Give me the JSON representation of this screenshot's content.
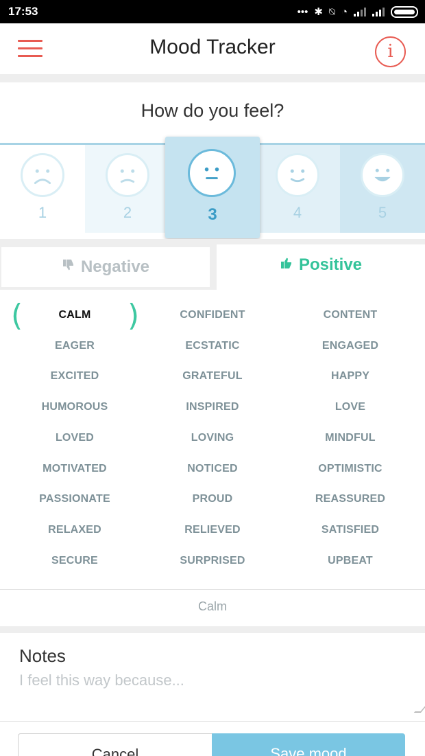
{
  "status_bar": {
    "time": "17:53",
    "dots": "•••",
    "bluetooth_glyph": "✱",
    "mute_glyph": "⍉",
    "wifi_glyph": "◔"
  },
  "app_bar": {
    "title": "Mood Tracker",
    "info_label": "i"
  },
  "question": "How do you feel?",
  "mood_scale": {
    "selected": 3,
    "levels": [
      {
        "label": "1",
        "face": "very-sad"
      },
      {
        "label": "2",
        "face": "sad"
      },
      {
        "label": "3",
        "face": "neutral"
      },
      {
        "label": "4",
        "face": "happy"
      },
      {
        "label": "5",
        "face": "very-happy"
      }
    ]
  },
  "tabs": {
    "negative": {
      "label": "Negative",
      "icon": "thumbs-down-icon"
    },
    "positive": {
      "label": "Positive",
      "icon": "thumbs-up-icon",
      "active": true
    }
  },
  "feelings": [
    "CALM",
    "CONFIDENT",
    "CONTENT",
    "EAGER",
    "ECSTATIC",
    "ENGAGED",
    "EXCITED",
    "GRATEFUL",
    "HAPPY",
    "HUMOROUS",
    "INSPIRED",
    "LOVE",
    "LOVED",
    "LOVING",
    "MINDFUL",
    "MOTIVATED",
    "NOTICED",
    "OPTIMISTIC",
    "PASSIONATE",
    "PROUD",
    "REASSURED",
    "RELAXED",
    "RELIEVED",
    "SATISFIED",
    "SECURE",
    "SURPRISED",
    "UPBEAT"
  ],
  "selected_feeling": "CALM",
  "selected_summary": "Calm",
  "notes": {
    "label": "Notes",
    "placeholder": "I feel this way because...",
    "value": ""
  },
  "buttons": {
    "cancel": "Cancel",
    "save": "Save mood"
  },
  "colors": {
    "accent_red": "#e85b52",
    "positive_green": "#34c39a",
    "scale_blue": "#c5e3f0",
    "save_blue": "#7ac6e3"
  }
}
